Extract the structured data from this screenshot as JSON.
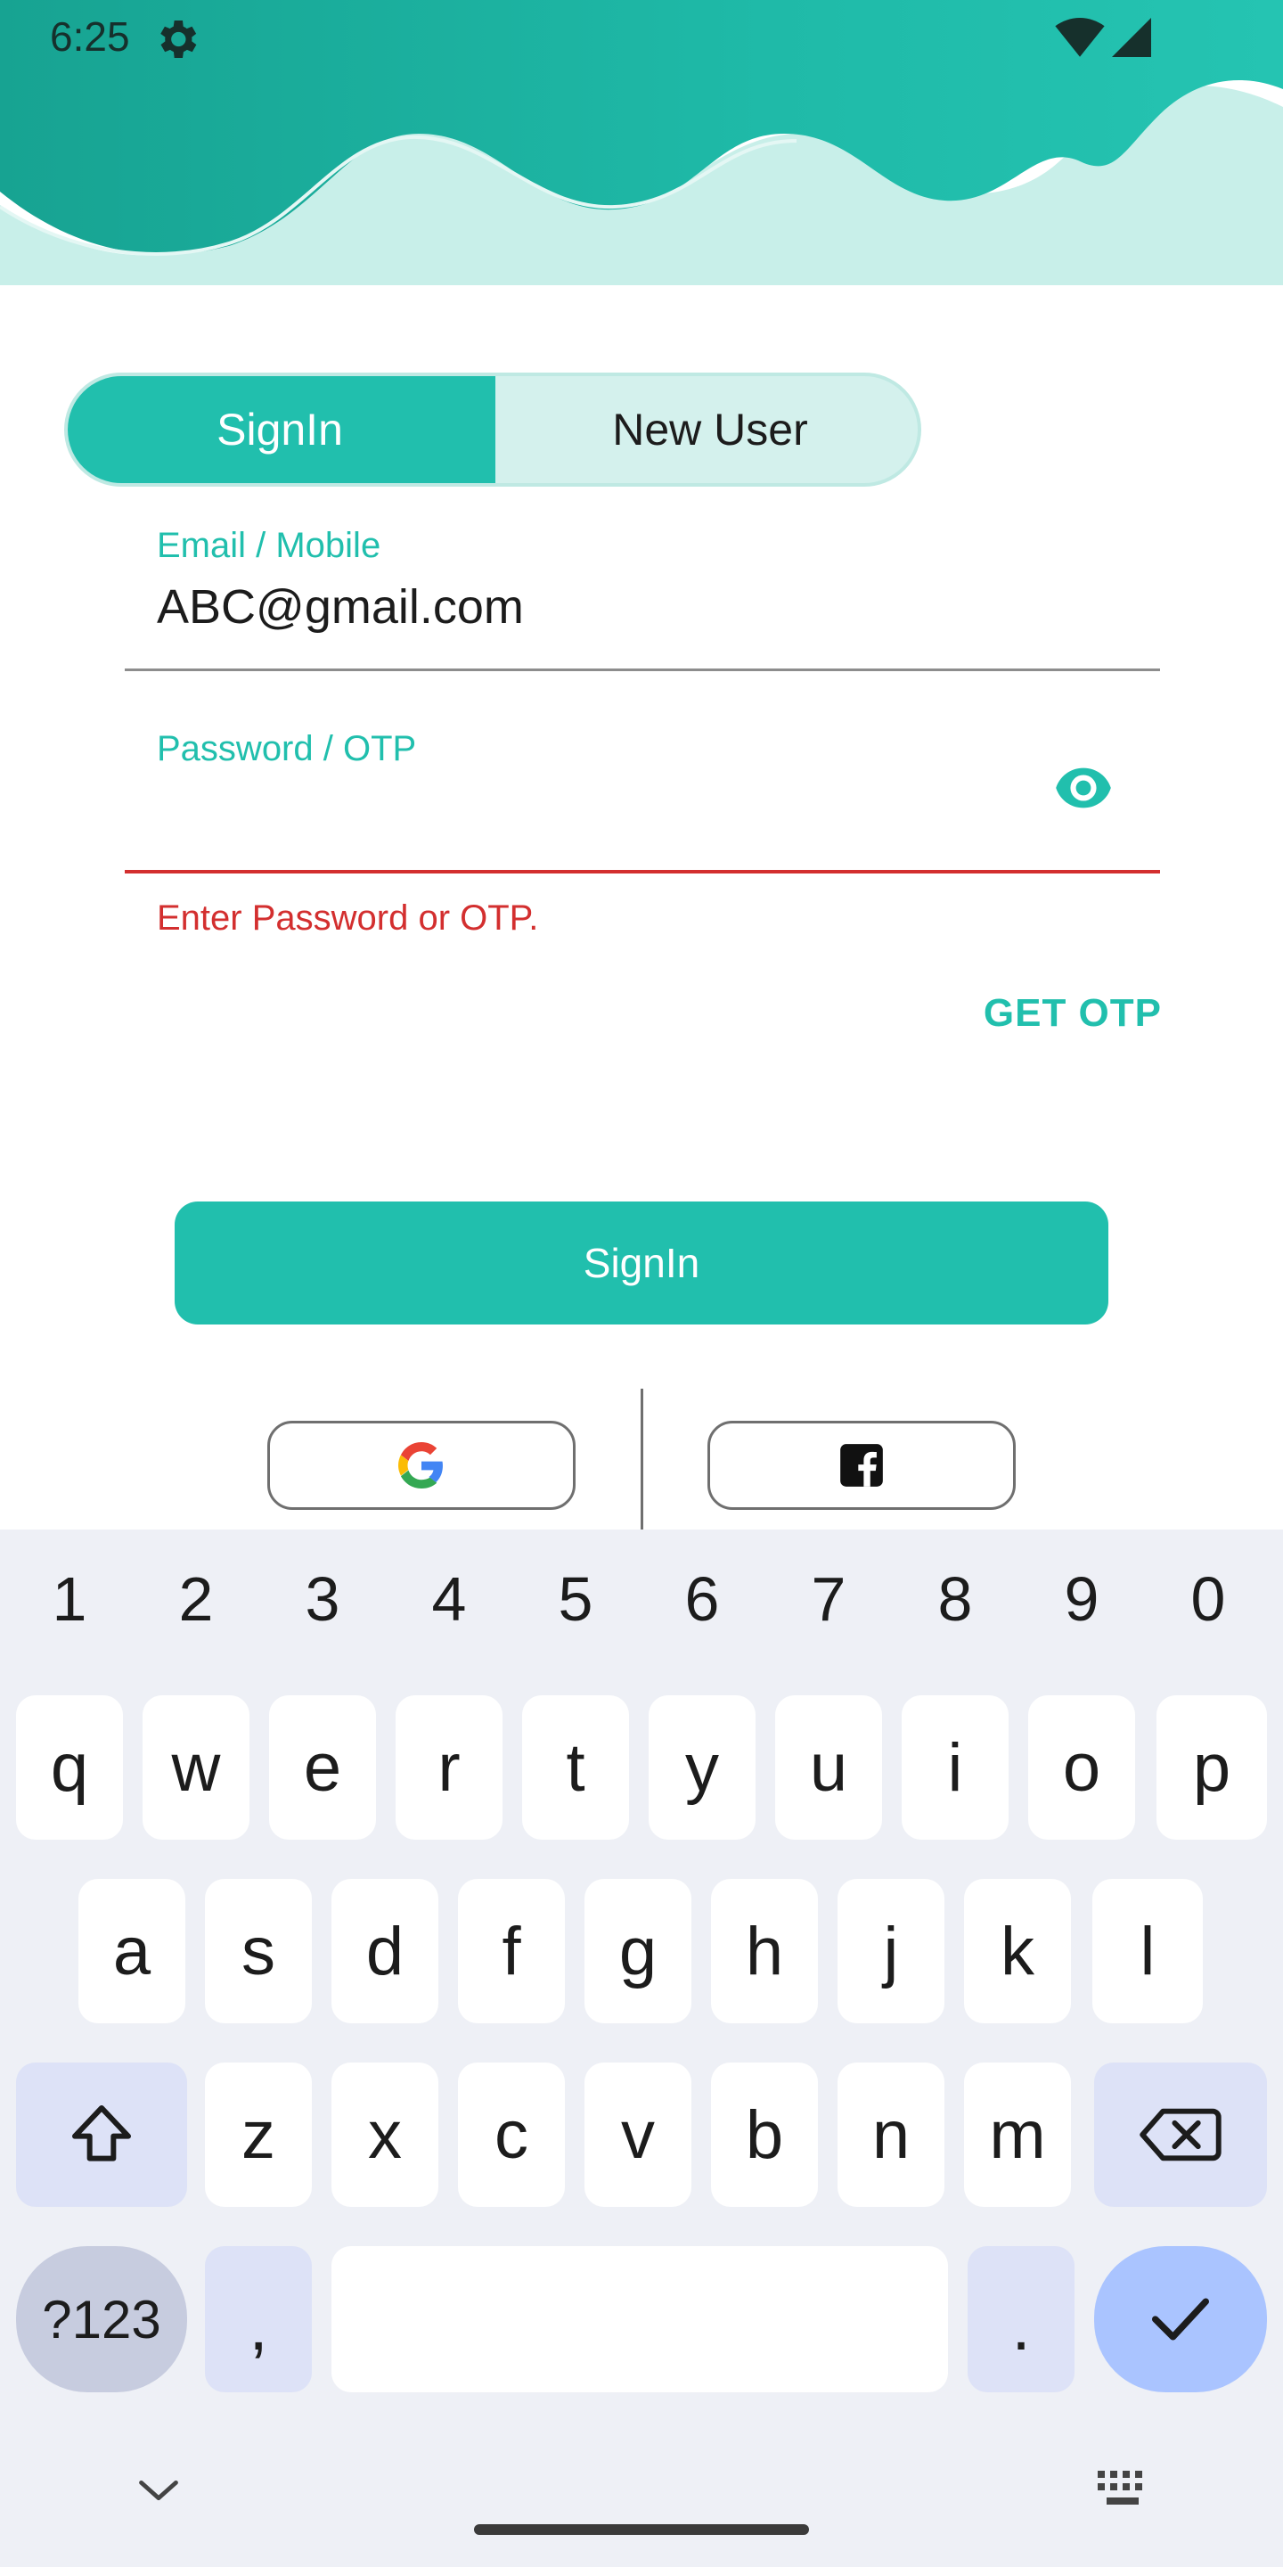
{
  "status_bar": {
    "time": "6:25"
  },
  "toggle": {
    "signin_label": "SignIn",
    "new_user_label": "New User"
  },
  "email_field": {
    "label": "Email / Mobile",
    "value": "ABC@gmail.com"
  },
  "password_field": {
    "label": "Password / OTP",
    "value": "",
    "error": "Enter Password or OTP."
  },
  "actions": {
    "get_otp": "GET OTP",
    "signin": "SignIn"
  },
  "colors": {
    "accent": "#21bfad",
    "error": "#d32f2f",
    "accent_light": "#d4f1ed"
  },
  "keyboard": {
    "numbers": [
      "1",
      "2",
      "3",
      "4",
      "5",
      "6",
      "7",
      "8",
      "9",
      "0"
    ],
    "row1": [
      "q",
      "w",
      "e",
      "r",
      "t",
      "y",
      "u",
      "i",
      "o",
      "p"
    ],
    "row2": [
      "a",
      "s",
      "d",
      "f",
      "g",
      "h",
      "j",
      "k",
      "l"
    ],
    "row3": [
      "z",
      "x",
      "c",
      "v",
      "b",
      "n",
      "m"
    ],
    "symbols_label": "?123",
    "comma": ",",
    "period": "."
  }
}
